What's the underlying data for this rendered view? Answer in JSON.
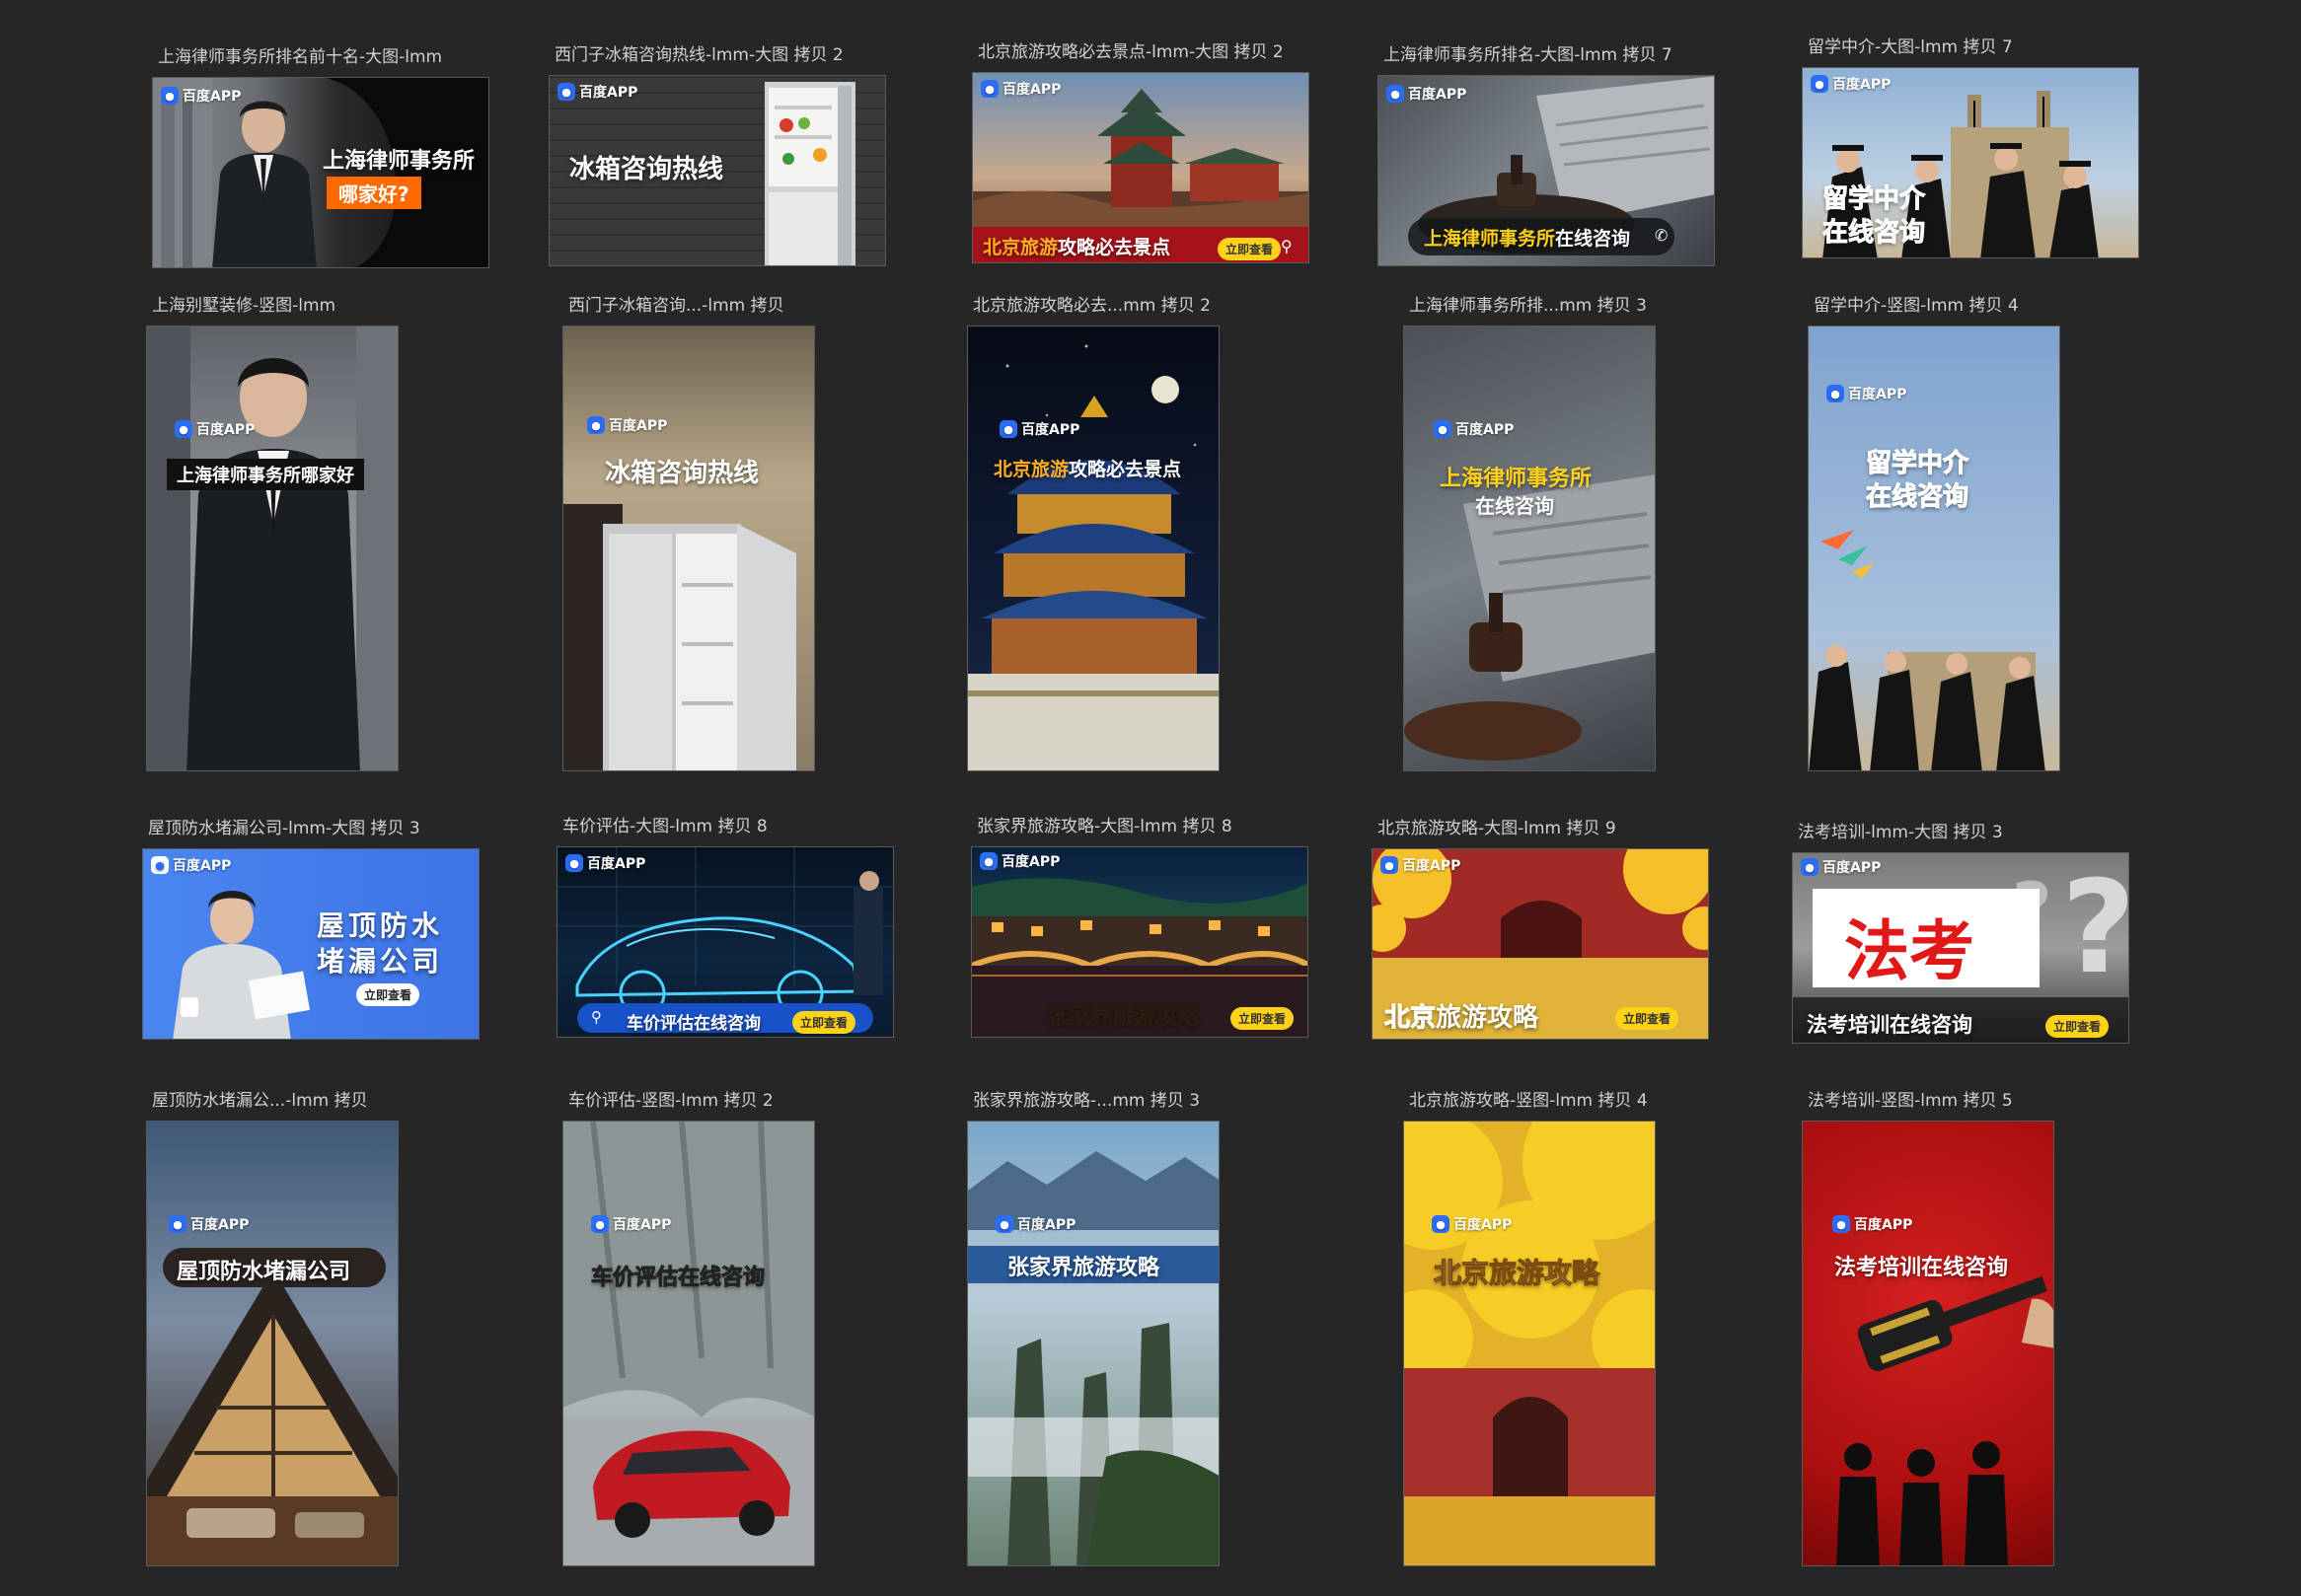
{
  "artboards": [
    {
      "label": "上海律师事务所排名前十名-大图-lmm",
      "logo": "百度APP",
      "headline": "上海律师事务所",
      "sub": "哪家好?"
    },
    {
      "label": "西门子冰箱咨询热线-lmm-大图 拷贝 2",
      "logo": "百度APP",
      "headline": "冰箱咨询热线"
    },
    {
      "label": "北京旅游攻略必去景点-lmm-大图 拷贝 2",
      "logo": "百度APP",
      "headline_a": "北京旅游",
      "headline_b": "攻略必去景点",
      "cta": "立即查看"
    },
    {
      "label": "上海律师事务所排名-大图-lmm 拷贝 7",
      "logo": "百度APP",
      "headline_a": "上海律师事务所",
      "headline_b": "在线咨询"
    },
    {
      "label": "留学中介-大图-lmm 拷贝 7",
      "logo": "百度APP",
      "headline": "留学中介",
      "sub": "在线咨询"
    },
    {
      "label": "上海别墅装修-竖图-lmm",
      "logo": "百度APP",
      "headline": "上海律师事务所哪家好"
    },
    {
      "label": "西门子冰箱咨询...-lmm 拷贝",
      "logo": "百度APP",
      "headline": "冰箱咨询热线"
    },
    {
      "label": "北京旅游攻略必去...mm 拷贝 2",
      "logo": "百度APP",
      "headline_a": "北京旅游",
      "headline_b": "攻略必去景点"
    },
    {
      "label": "上海律师事务所排...mm 拷贝 3",
      "logo": "百度APP",
      "headline": "上海律师事务所",
      "sub": "在线咨询"
    },
    {
      "label": "留学中介-竖图-lmm 拷贝 4",
      "logo": "百度APP",
      "headline": "留学中介",
      "sub": "在线咨询"
    },
    {
      "label": "屋顶防水堵漏公司-lmm-大图 拷贝 3",
      "logo": "百度APP",
      "headline": "屋顶防水",
      "sub": "堵漏公司",
      "cta": "立即查看"
    },
    {
      "label": "车价评估-大图-lmm 拷贝 8",
      "logo": "百度APP",
      "headline": "车价评估在线咨询",
      "cta": "立即查看"
    },
    {
      "label": "张家界旅游攻略-大图-lmm 拷贝 8",
      "logo": "百度APP",
      "headline": "张家界旅游攻略",
      "cta": "立即查看"
    },
    {
      "label": "北京旅游攻略-大图-lmm 拷贝 9",
      "logo": "百度APP",
      "headline_a": "北京",
      "headline_b": "旅游攻略",
      "cta": "立即查看"
    },
    {
      "label": "法考培训-lmm-大图 拷贝 3",
      "logo": "百度APP",
      "headline": "法考",
      "sub": "法考培训在线咨询",
      "cta": "立即查看"
    },
    {
      "label": "屋顶防水堵漏公...-lmm 拷贝",
      "logo": "百度APP",
      "headline": "屋顶防水堵漏公司"
    },
    {
      "label": "车价评估-竖图-lmm 拷贝 2",
      "logo": "百度APP",
      "headline": "车价评估在线咨询"
    },
    {
      "label": "张家界旅游攻略-...mm 拷贝 3",
      "logo": "百度APP",
      "headline": "张家界旅游攻略"
    },
    {
      "label": "北京旅游攻略-竖图-lmm 拷贝 4",
      "logo": "百度APP",
      "headline": "北京旅游攻略"
    },
    {
      "label": "法考培训-竖图-lmm 拷贝 5",
      "logo": "百度APP",
      "headline": "法考培训在线咨询"
    }
  ]
}
